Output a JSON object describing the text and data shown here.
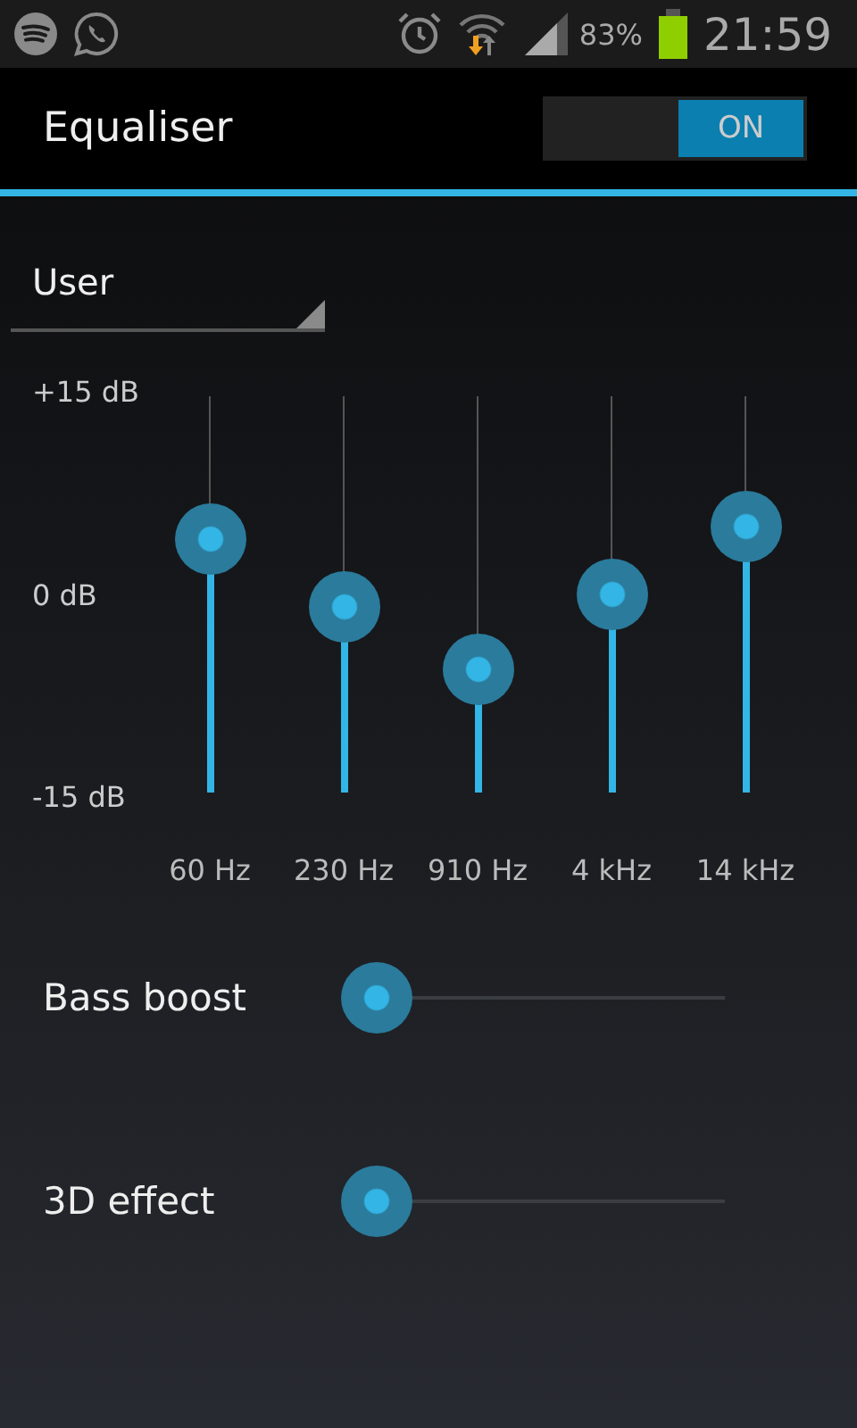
{
  "status_bar": {
    "battery_percent": "83%",
    "time": "21:59"
  },
  "action_bar": {
    "title": "Equaliser",
    "toggle": {
      "label": "ON",
      "on": true
    }
  },
  "preset": {
    "value": "User"
  },
  "equalizer": {
    "scale": [
      "+15 dB",
      "0 dB",
      "-15 dB"
    ],
    "bands": [
      {
        "label": "60 Hz",
        "level": 0.64
      },
      {
        "label": "230 Hz",
        "level": 0.47
      },
      {
        "label": "910 Hz",
        "level": 0.31
      },
      {
        "label": "4 kHz",
        "level": 0.5
      },
      {
        "label": "14 kHz",
        "level": 0.67
      }
    ]
  },
  "effects": [
    {
      "label": "Bass boost",
      "level": 0
    },
    {
      "label": "3D effect",
      "level": 0
    }
  ]
}
